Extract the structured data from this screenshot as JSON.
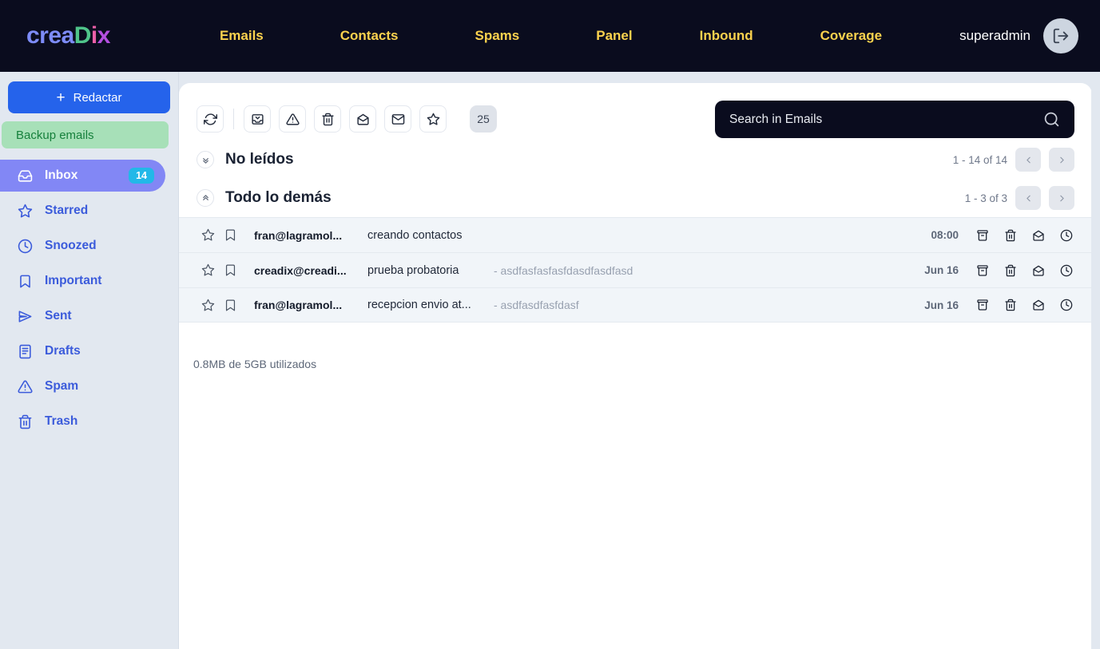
{
  "header": {
    "logo_parts": [
      "crea",
      "D",
      "i",
      "x"
    ],
    "nav": [
      {
        "label": "Emails",
        "name": "nav-emails"
      },
      {
        "label": "Contacts",
        "name": "nav-contacts"
      },
      {
        "label": "Spams",
        "name": "nav-spams"
      },
      {
        "label": "Panel",
        "name": "nav-panel"
      },
      {
        "label": "Inbound",
        "name": "nav-inbound"
      },
      {
        "label": "Coverage",
        "name": "nav-coverage"
      }
    ],
    "username": "superadmin",
    "logout_icon": "logout-icon",
    "nav_color": "#fbd24e",
    "bg_color": "#0a0c1e"
  },
  "sidebar": {
    "compose_label": "Redactar",
    "backup_label": "Backup emails",
    "items": [
      {
        "label": "Inbox",
        "icon": "inbox-icon",
        "badge": "14",
        "active": true
      },
      {
        "label": "Starred",
        "icon": "star-icon",
        "badge": "",
        "active": false
      },
      {
        "label": "Snoozed",
        "icon": "clock-icon",
        "badge": "",
        "active": false
      },
      {
        "label": "Important",
        "icon": "bookmark-icon",
        "badge": "",
        "active": false
      },
      {
        "label": "Sent",
        "icon": "send-icon",
        "badge": "",
        "active": false
      },
      {
        "label": "Drafts",
        "icon": "document-icon",
        "badge": "",
        "active": false
      },
      {
        "label": "Spam",
        "icon": "warning-icon",
        "badge": "",
        "active": false
      },
      {
        "label": "Trash",
        "icon": "trash-icon",
        "badge": "",
        "active": false
      }
    ],
    "active_color": "#8287f5",
    "badge_color": "#22b8e8",
    "link_color": "#3b5bdb"
  },
  "toolbar": {
    "buttons": [
      {
        "icon": "refresh-icon",
        "name": "refresh-button"
      },
      {
        "icon": "archive-download-icon",
        "name": "archive-button"
      },
      {
        "icon": "warning-icon",
        "name": "report-spam-button"
      },
      {
        "icon": "trash-icon",
        "name": "delete-button"
      },
      {
        "icon": "envelope-open-icon",
        "name": "mark-read-button"
      },
      {
        "icon": "envelope-closed-icon",
        "name": "mark-unread-button"
      },
      {
        "icon": "star-icon",
        "name": "star-button"
      }
    ],
    "count_badge": "25"
  },
  "search": {
    "placeholder": "Search in Emails",
    "value": "",
    "icon": "search-icon"
  },
  "sections": [
    {
      "title": "No leídos",
      "chevron": "chevron-double-down-icon",
      "pager_text": "1 - 14 of 14",
      "prev_icon": "chevron-left-icon",
      "next_icon": "chevron-right-icon"
    },
    {
      "title": "Todo lo demás",
      "chevron": "chevron-double-up-icon",
      "pager_text": "1 - 3 of 3",
      "prev_icon": "chevron-left-icon",
      "next_icon": "chevron-right-icon"
    }
  ],
  "emails": [
    {
      "sender": "fran@lagramol...",
      "subject": "creando contactos",
      "preview": "",
      "date": "08:00"
    },
    {
      "sender": "creadix@creadi...",
      "subject": "prueba probatoria",
      "preview": "- asdfasfasfasfdasdfasdfasd",
      "date": "Jun 16"
    },
    {
      "sender": "fran@lagramol...",
      "subject": "recepcion envio at...",
      "preview": "- asdfasdfasfdasf",
      "date": "Jun 16"
    }
  ],
  "row_actions": [
    {
      "icon": "archive-icon",
      "name": "row-archive-button"
    },
    {
      "icon": "trash-icon",
      "name": "row-delete-button"
    },
    {
      "icon": "envelope-open-icon",
      "name": "row-mark-read-button"
    },
    {
      "icon": "clock-icon",
      "name": "row-snooze-button"
    }
  ],
  "storage": {
    "text": "0.8MB de 5GB utilizados"
  }
}
